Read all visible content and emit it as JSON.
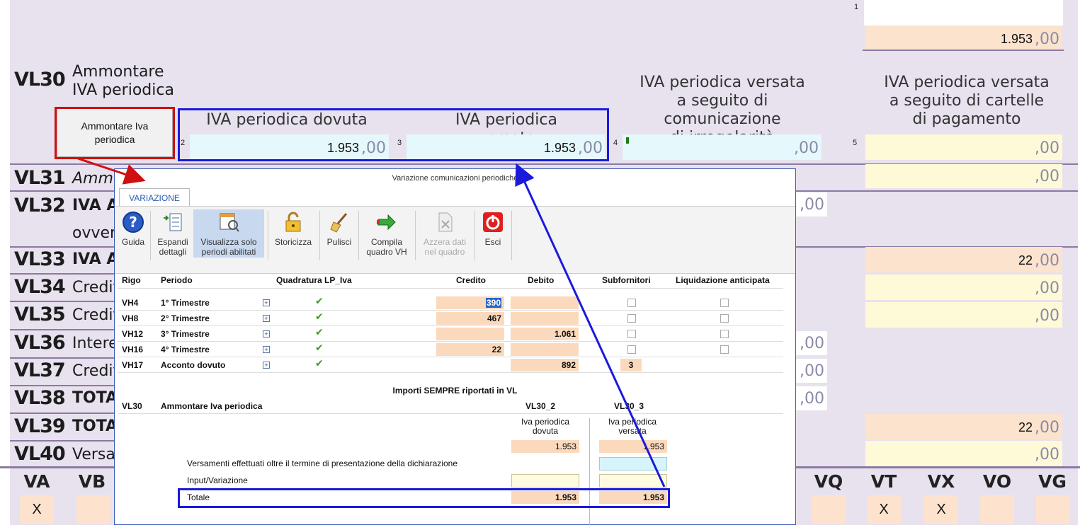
{
  "form": {
    "top_index": "1",
    "top_value": "1.953",
    "dec": ",00",
    "vl30": {
      "code": "VL30",
      "label_line1": "Ammontare",
      "label_line2": "IVA periodica"
    },
    "button": "Ammontare Iva periodica",
    "heads": {
      "h2": "IVA periodica dovuta",
      "h3": "IVA periodica versata",
      "h4": [
        "IVA periodica versata",
        "a seguito di comunicazione",
        "di irregolarità"
      ],
      "h5": [
        "IVA periodica versata",
        "a seguito di cartelle",
        "di pagamento"
      ]
    },
    "fields": {
      "f2_idx": "2",
      "f2": "1.953",
      "f3_idx": "3",
      "f3": "1.953",
      "f4_idx": "4",
      "f5_idx": "5"
    },
    "rows": [
      {
        "code": "VL31",
        "label": "Ammo"
      },
      {
        "code": "VL32",
        "label": "IVA A",
        "label2": "ovver"
      },
      {
        "code": "VL33",
        "label": "IVA A",
        "value": "22"
      },
      {
        "code": "VL34",
        "label": "Credit"
      },
      {
        "code": "VL35",
        "label": "Credit"
      },
      {
        "code": "VL36",
        "label": "Interes"
      },
      {
        "code": "VL37",
        "label": "Credito"
      },
      {
        "code": "VL38",
        "label": "TOTAL"
      },
      {
        "code": "VL39",
        "label": "TOTAL",
        "value": "22"
      },
      {
        "code": "VL40",
        "label": "Versar"
      }
    ],
    "bottom": {
      "labels": [
        "VA",
        "VB",
        "VQ",
        "VT",
        "VX",
        "VO",
        "VG"
      ],
      "marks": {
        "VA": "X",
        "VT": "X",
        "VX": "X"
      }
    }
  },
  "dialog": {
    "title": "Variazione comunicazioni periodiche",
    "tab": "VARIAZIONE",
    "toolbar": {
      "guida": "Guida",
      "espandi": [
        "Espandi",
        "dettagli"
      ],
      "visualizza": [
        "Visualizza solo",
        "periodi abilitati"
      ],
      "storicizza": "Storicizza",
      "pulisci": "Pulisci",
      "compila": [
        "Compila",
        "quadro VH"
      ],
      "azzera": [
        "Azzera dati",
        "nel quadro"
      ],
      "esci": "Esci"
    },
    "columns": {
      "rigo": "Rigo",
      "periodo": "Periodo",
      "quadratura": "Quadratura LP_Iva",
      "credito": "Credito",
      "debito": "Debito",
      "subfornitori": "Subfornitori",
      "liquidazione": "Liquidazione anticipata"
    },
    "table": [
      {
        "rigo": "VH4",
        "periodo": "1° Trimestre",
        "credito": "390",
        "debito": ""
      },
      {
        "rigo": "VH8",
        "periodo": "2° Trimestre",
        "credito": "467",
        "debito": ""
      },
      {
        "rigo": "VH12",
        "periodo": "3° Trimestre",
        "credito": "",
        "debito": "1.061"
      },
      {
        "rigo": "VH16",
        "periodo": "4° Trimestre",
        "credito": "22",
        "debito": ""
      },
      {
        "rigo": "VH17",
        "periodo": "Acconto dovuto",
        "credito": "",
        "debito": "892",
        "sub": "3"
      }
    ],
    "section_title": "Importi SEMPRE riportati in VL",
    "vl30": {
      "code": "VL30",
      "label": "Ammontare Iva periodica",
      "col2": "VL30_2",
      "col3": "VL30_3"
    },
    "sub": {
      "col2_head": [
        "Iva periodica",
        "dovuta"
      ],
      "col3_head": [
        "Iva periodica",
        "versata"
      ],
      "col2_value": "1.953",
      "col3_value": "1.953",
      "versamenti": "Versamenti effettuati oltre il termine di presentazione della dichiarazione",
      "input": "Input/Variazione",
      "totale": "Totale",
      "tot2": "1.953",
      "tot3": "1.953"
    }
  },
  "colors": {
    "accent_red": "#d01010",
    "accent_blue": "#1a1adc",
    "peach": "#fce3cd",
    "yellow": "#fefad8",
    "cyan": "#e5f8fb"
  }
}
